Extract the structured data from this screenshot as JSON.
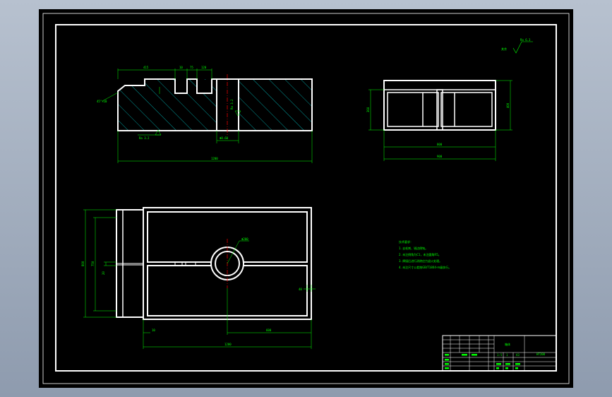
{
  "drawing": {
    "surface_symbol": {
      "label": "其余",
      "value": "Ra 6.3"
    },
    "section_view": {
      "dims": {
        "overall_width": "1200",
        "left_step": "415",
        "slot_a": "10",
        "slot_b": "75",
        "slot_c": "120",
        "tube_ref": "Φ8.60",
        "chamfer": "45°×10",
        "rough_bottom": "Ra 3.2",
        "rough_slot": "Ra 3.2"
      }
    },
    "side_view": {
      "dims": {
        "inner_width": "800",
        "outer_width": "900",
        "height_left": "360",
        "height_right": "400"
      }
    },
    "plan_view": {
      "dims": {
        "total_length": "1200",
        "hole_offset": "600",
        "flange": "10",
        "height_outer": "800",
        "height_inner": "750",
        "mid_gap": "20",
        "right_tab": "40",
        "hole_diameter": "Φ200"
      }
    },
    "tech_notes": {
      "title": "技术要求：",
      "lines": [
        "1. 去毛刺、锐边倒钝。",
        "2. 未注倒角为C1，未注圆角R5。",
        "3. 焊接后进行消除应力退火处理。",
        "4. 未注尺寸公差按GB/T1804-m级执行。"
      ]
    },
    "title_block": {
      "part_name": "箱体",
      "material": "HT200",
      "scale": "1:5",
      "sheet": "1",
      "drawing_no": "A3"
    },
    "colors": {
      "outline": "#ffffff",
      "dimension": "#00ff00",
      "hatch": "#00ffff",
      "centerline": "#ff0000",
      "background": "#000000"
    }
  }
}
